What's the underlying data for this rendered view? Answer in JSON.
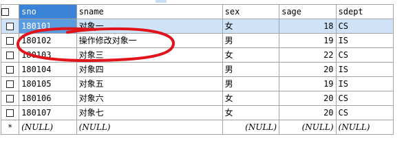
{
  "columns": [
    "sno",
    "sname",
    "sex",
    "sage",
    "sdept"
  ],
  "rows": [
    {
      "sno": "180101",
      "sname": "对象一",
      "sex": "女",
      "sage": "18",
      "sdept": "CS"
    },
    {
      "sno": "180102",
      "sname": "操作修改对象一",
      "sex": "男",
      "sage": "19",
      "sdept": "IS"
    },
    {
      "sno": "180103",
      "sname": "对象三",
      "sex": "女",
      "sage": "22",
      "sdept": "CS"
    },
    {
      "sno": "180104",
      "sname": "对象四",
      "sex": "男",
      "sage": "20",
      "sdept": "IS"
    },
    {
      "sno": "180105",
      "sname": "对象五",
      "sex": "男",
      "sage": "19",
      "sdept": "IS"
    },
    {
      "sno": "180106",
      "sname": "对象六",
      "sex": "女",
      "sage": "20",
      "sdept": "CS"
    },
    {
      "sno": "180107",
      "sname": "对象七",
      "sex": "女",
      "sage": "20",
      "sdept": "CS"
    }
  ],
  "new_row": {
    "marker": "*",
    "sno": "(NULL)",
    "sname": "(NULL)",
    "sex": "(NULL)",
    "sage": "(NULL)",
    "sdept": "(NULL)"
  },
  "selected_row_index": 0,
  "selected_column": "sno",
  "colors": {
    "header_selected": "#3b83d6",
    "row_selected": "#cfe3f8",
    "annotation_stroke": "#e0141a"
  },
  "icons": {
    "row_checkbox": "checkbox-icon",
    "annotation": "red-circle-annotation"
  }
}
